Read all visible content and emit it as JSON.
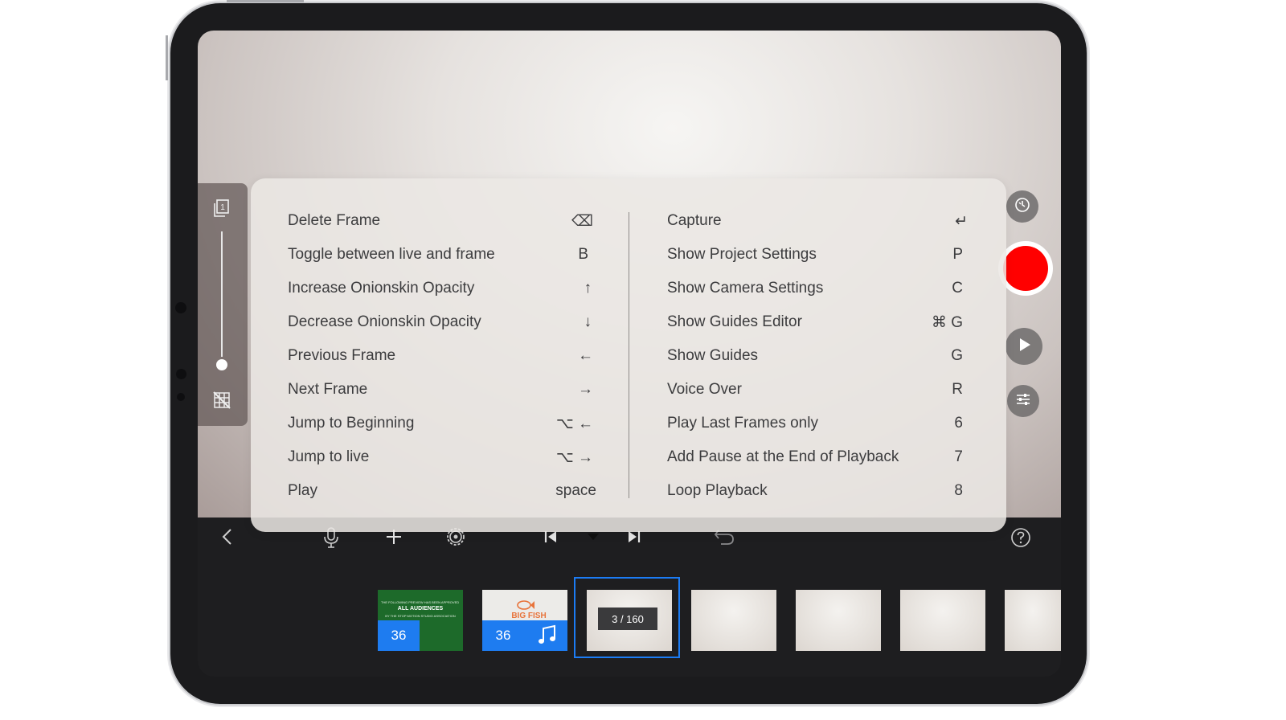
{
  "shortcuts": {
    "left": [
      {
        "label": "Delete Frame",
        "key": "⌫"
      },
      {
        "label": "Toggle between live and frame",
        "key": "B"
      },
      {
        "label": "Increase Onionskin Opacity",
        "key": "↑"
      },
      {
        "label": "Decrease Onionskin Opacity",
        "key": "↓"
      },
      {
        "label": "Previous Frame",
        "key": "←"
      },
      {
        "label": "Next Frame",
        "key": "→"
      },
      {
        "label": "Jump to Beginning",
        "key": "⌥  ←"
      },
      {
        "label": "Jump to live",
        "key": "⌥  →"
      },
      {
        "label": "Play",
        "key": "space"
      }
    ],
    "right": [
      {
        "label": "Capture",
        "key": "↵"
      },
      {
        "label": "Show Project Settings",
        "key": "P"
      },
      {
        "label": "Show Camera Settings",
        "key": "C"
      },
      {
        "label": "Show Guides Editor",
        "key": "⌘  G"
      },
      {
        "label": "Show Guides",
        "key": "G"
      },
      {
        "label": "Voice Over",
        "key": "R"
      },
      {
        "label": "Play Last Frames only",
        "key": "6"
      },
      {
        "label": "Add Pause at the End of Playback",
        "key": "7"
      },
      {
        "label": "Loop Playback",
        "key": "8"
      }
    ]
  },
  "filmstrip": {
    "clip1": {
      "count": "36",
      "title_line1": "THE FOLLOWING PREVIEW HAS BEEN APPROVED FOR",
      "title_line2": "ALL AUDIENCES",
      "title_line3": "BY THE STOP MOTION STUDIO ASSOCIATION"
    },
    "clip2": {
      "count": "36",
      "title": "BIG FISH"
    },
    "current": {
      "counter": "3 / 160"
    }
  },
  "colors": {
    "accent": "#1e7cf0",
    "record": "#ff0000",
    "selection": "#1c7cf4"
  },
  "icons": {
    "onionskin_top": "single-frame-icon",
    "onionskin_bottom": "grid-off-icon",
    "timer": "timer-icon",
    "play": "play-icon",
    "settings": "sliders-icon",
    "back": "chevron-left-icon",
    "mic": "microphone-icon",
    "add": "plus-icon",
    "gear": "gear-icon",
    "skip_start": "skip-to-start-icon",
    "skip_end": "skip-to-end-icon",
    "undo": "undo-icon",
    "help": "help-icon",
    "music": "music-note-icon"
  }
}
